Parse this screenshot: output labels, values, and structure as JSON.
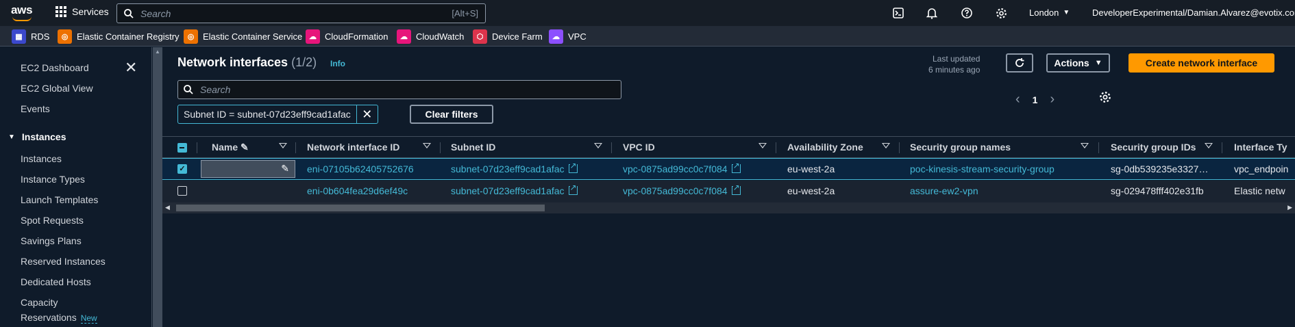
{
  "topnav": {
    "logo": "aws",
    "services_label": "Services",
    "search_placeholder": "Search",
    "search_shortcut": "[Alt+S]",
    "region": "London",
    "account": "DeveloperExperimental/Damian.Alvarez@evotix.com"
  },
  "favorites": [
    {
      "label": "RDS",
      "color": "#3b48cc",
      "icon": "rds-icon"
    },
    {
      "label": "Elastic Container Registry",
      "color": "#ed7100",
      "icon": "ecr-icon"
    },
    {
      "label": "Elastic Container Service",
      "color": "#ed7100",
      "icon": "ecs-icon"
    },
    {
      "label": "CloudFormation",
      "color": "#e7157b",
      "icon": "cloudformation-icon"
    },
    {
      "label": "CloudWatch",
      "color": "#e7157b",
      "icon": "cloudwatch-icon"
    },
    {
      "label": "Device Farm",
      "color": "#dd344c",
      "icon": "device-farm-icon"
    },
    {
      "label": "VPC",
      "color": "#8c4fff",
      "icon": "vpc-icon"
    }
  ],
  "sidebar": {
    "top_items": [
      "EC2 Dashboard",
      "EC2 Global View",
      "Events"
    ],
    "section": "Instances",
    "items": [
      "Instances",
      "Instance Types",
      "Launch Templates",
      "Spot Requests",
      "Savings Plans",
      "Reserved Instances",
      "Dedicated Hosts",
      "Capacity"
    ],
    "last_item_line2": "Reservations",
    "new_badge": "New"
  },
  "header": {
    "title": "Network interfaces",
    "count": "(1/2)",
    "info": "Info",
    "last_updated_line1": "Last updated",
    "last_updated_line2": "6 minutes ago",
    "actions_label": "Actions",
    "create_label": "Create network interface"
  },
  "filter": {
    "search_placeholder": "Search",
    "chip": "Subnet ID = subnet-07d23eff9cad1afac",
    "clear_label": "Clear filters",
    "page": "1"
  },
  "table": {
    "columns": [
      "Name",
      "Network interface ID",
      "Subnet ID",
      "VPC ID",
      "Availability Zone",
      "Security group names",
      "Security group IDs",
      "Interface Ty"
    ],
    "rows": [
      {
        "selected": true,
        "name": "",
        "eni": "eni-07105b62405752676",
        "subnet": "subnet-07d23eff9cad1afac",
        "vpc": "vpc-0875ad99cc0c7f084",
        "az": "eu-west-2a",
        "sg_names": "poc-kinesis-stream-security-group",
        "sg_ids": "sg-0db539235e3327…",
        "type": "vpc_endpoin"
      },
      {
        "selected": false,
        "name": "",
        "eni": "eni-0b604fea29d6ef49c",
        "subnet": "subnet-07d23eff9cad1afac",
        "vpc": "vpc-0875ad99cc0c7f084",
        "az": "eu-west-2a",
        "sg_names": "assure-ew2-vpn",
        "sg_ids": "sg-029478fff402e31fb",
        "type": "Elastic netw"
      }
    ]
  }
}
